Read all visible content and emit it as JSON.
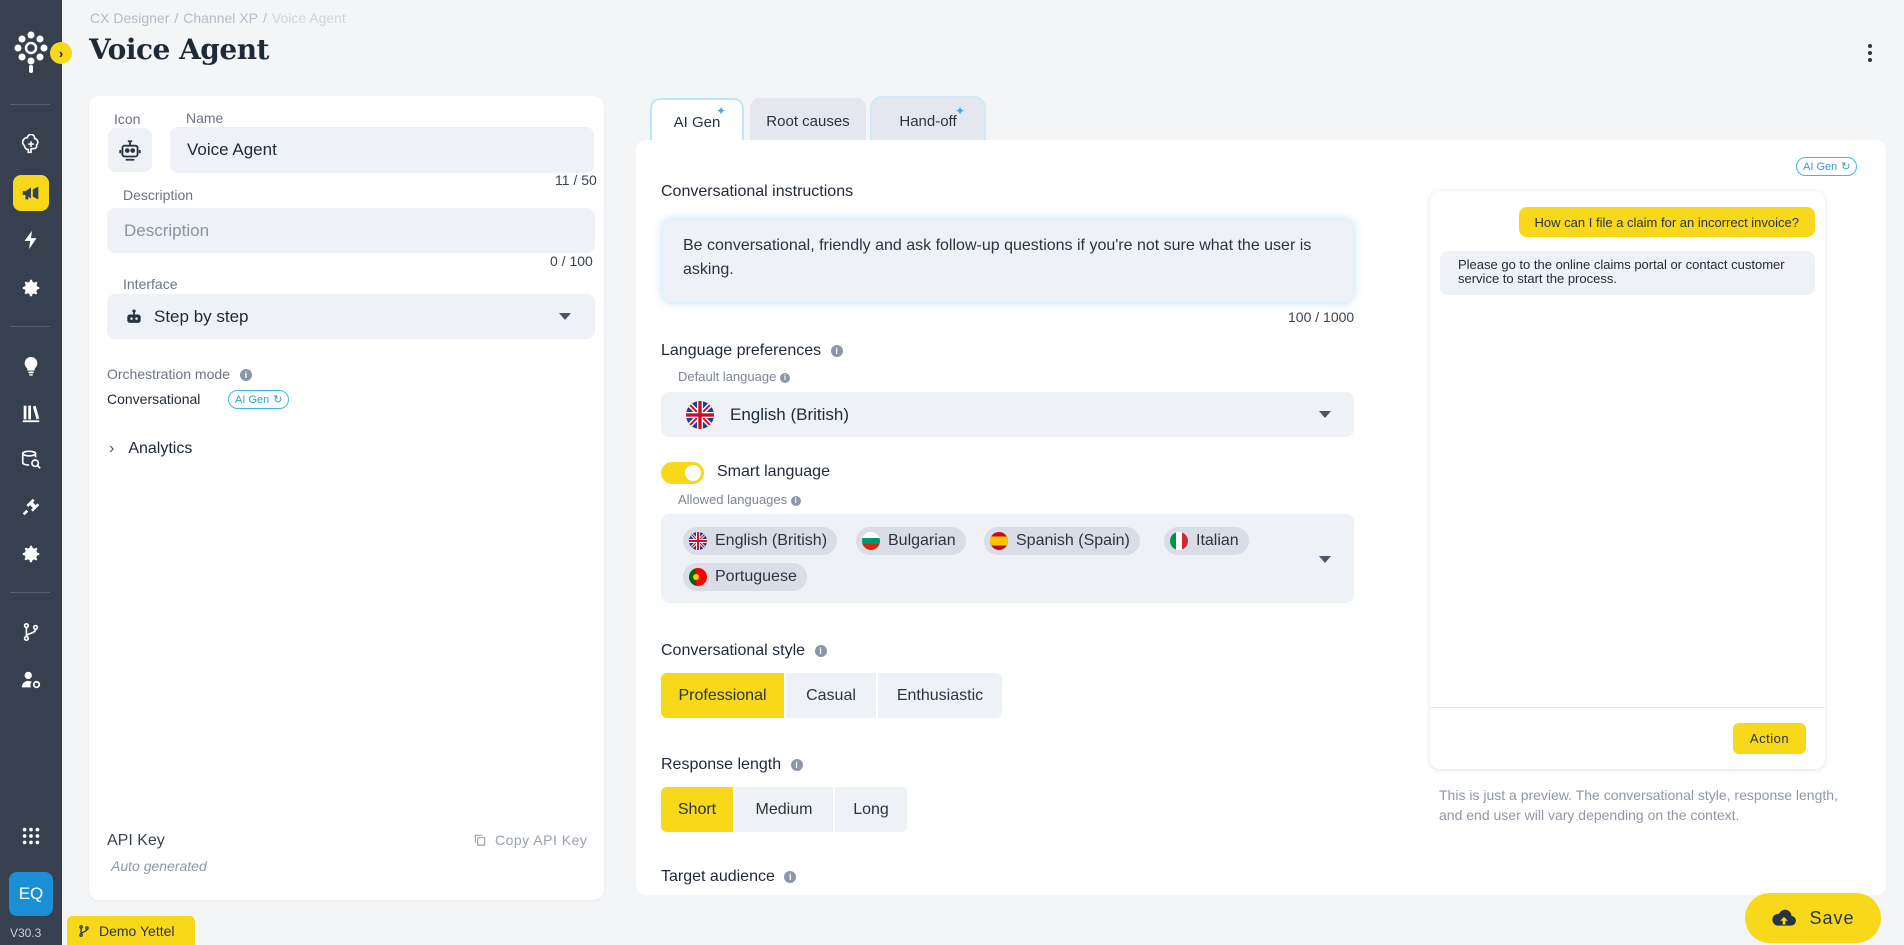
{
  "app": {
    "version": "V30.3",
    "user_initials": "EQ",
    "branch_label": "Demo Yettel",
    "accent_color": "#f8d81a",
    "rail_color": "#36404f"
  },
  "breadcrumb": [
    "CX Designer",
    "Channel XP",
    "Voice Agent"
  ],
  "page_title": "Voice Agent",
  "left_panel": {
    "icon_label": "Icon",
    "name_label": "Name",
    "name_value": "Voice Agent",
    "name_counter": "11 / 50",
    "description_label": "Description",
    "description_placeholder": "Description",
    "description_counter": "0 / 100",
    "interface_label": "Interface",
    "interface_value": "Step by step",
    "orchestration_label": "Orchestration mode",
    "orchestration_value": "Conversational",
    "ai_badge": "AI Gen",
    "analytics_label": "Analytics",
    "api_key_label": "API Key",
    "api_key_value": "Auto generated",
    "copy_api_key": "Copy API Key"
  },
  "tabs": [
    {
      "label": "AI Gen",
      "active": true
    },
    {
      "label": "Root causes",
      "active": false
    },
    {
      "label": "Hand-off",
      "active": false
    }
  ],
  "main": {
    "ai_badge": "AI Gen",
    "instructions_title": "Conversational instructions",
    "instructions_text": "Be conversational, friendly and ask follow-up questions if you're not sure what the user is asking.",
    "instructions_counter": "100 / 1000",
    "language_title": "Language preferences",
    "default_language_label": "Default language",
    "default_language_value": "English (British)",
    "smart_language_label": "Smart language",
    "smart_language_on": true,
    "allowed_languages_label": "Allowed languages",
    "allowed_languages": [
      "English (British)",
      "Bulgarian",
      "Spanish (Spain)",
      "Italian",
      "Portuguese"
    ],
    "style_title": "Conversational style",
    "style_options": [
      "Professional",
      "Casual",
      "Enthusiastic"
    ],
    "style_selected": "Professional",
    "length_title": "Response length",
    "length_options": [
      "Short",
      "Medium",
      "Long"
    ],
    "length_selected": "Short",
    "audience_title": "Target audience"
  },
  "preview": {
    "user_message": "How can I file a claim for an incorrect invoice?",
    "agent_message": "Please go to the online claims portal or contact customer service to start the process.",
    "action_label": "Action",
    "note": "This is just a preview. The conversational style, response length, and end user will vary depending on the context."
  },
  "save_label": "Save"
}
